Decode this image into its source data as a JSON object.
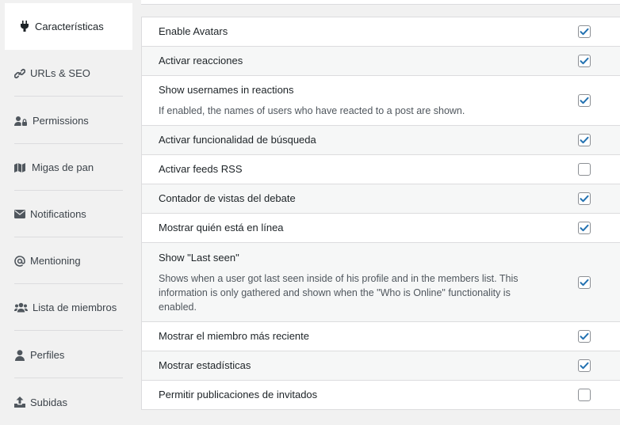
{
  "sidebar": {
    "items": [
      {
        "label": "Características",
        "icon": "plug-icon",
        "active": true
      },
      {
        "label": "URLs & SEO",
        "icon": "link-icon"
      },
      {
        "label": "Permissions",
        "icon": "user-lock-icon"
      },
      {
        "label": "Migas de pan",
        "icon": "map-icon"
      },
      {
        "label": "Notifications",
        "icon": "envelope-icon"
      },
      {
        "label": "Mentioning",
        "icon": "at-icon"
      },
      {
        "label": "Lista de miembros",
        "icon": "users-icon"
      },
      {
        "label": "Perfiles",
        "icon": "user-icon"
      },
      {
        "label": "Subidas",
        "icon": "upload-icon"
      }
    ]
  },
  "settings": {
    "rows": [
      {
        "title": "Enable Avatars",
        "checked": true
      },
      {
        "title": "Activar reacciones",
        "checked": true
      },
      {
        "title": "Show usernames in reactions",
        "description": "If enabled, the names of users who have reacted to a post are shown.",
        "checked": true
      },
      {
        "title": "Activar funcionalidad de búsqueda",
        "checked": true
      },
      {
        "title": "Activar feeds RSS",
        "checked": false
      },
      {
        "title": "Contador de vistas del debate",
        "checked": true
      },
      {
        "title": "Mostrar quién está en línea",
        "checked": true
      },
      {
        "title": "Show \"Last seen\"",
        "description": "Shows when a user got last seen inside of his profile and in the members list. This information is only gathered and shown when the \"Who is Online\" functionality is enabled.",
        "checked": true
      },
      {
        "title": "Mostrar el miembro más reciente",
        "checked": true
      },
      {
        "title": "Mostrar estadísticas",
        "checked": true
      },
      {
        "title": "Permitir publicaciones de invitados",
        "checked": false
      }
    ]
  },
  "colors": {
    "checkmark": "#2271b1",
    "active_tab_bg": "#ffffff",
    "row_alt_bg": "#f6f7f7"
  }
}
